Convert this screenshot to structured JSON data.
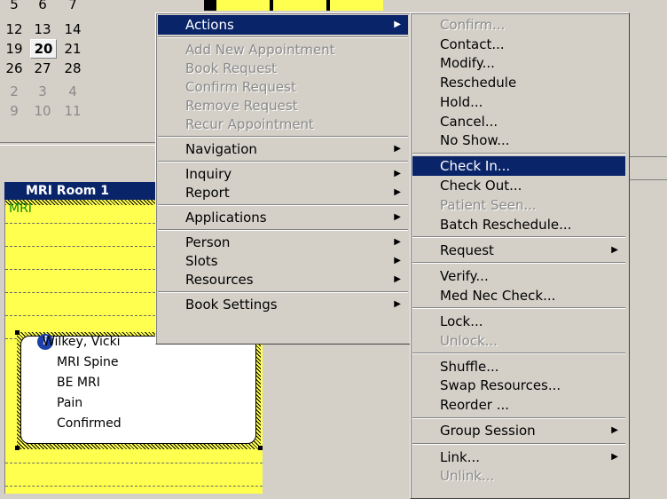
{
  "calendar": {
    "rows": [
      {
        "cells": [
          {
            "t": "5",
            "dim": false
          },
          {
            "t": "6",
            "dim": false
          },
          {
            "t": "7",
            "dim": false
          }
        ]
      },
      {
        "cells": [
          {
            "t": "12",
            "dim": false
          },
          {
            "t": "13",
            "dim": false
          },
          {
            "t": "14",
            "dim": false
          }
        ]
      },
      {
        "cells": [
          {
            "t": "19",
            "dim": false
          },
          {
            "t": "20",
            "dim": false,
            "today": true
          },
          {
            "t": "21",
            "dim": false
          }
        ]
      },
      {
        "cells": [
          {
            "t": "26",
            "dim": false
          },
          {
            "t": "27",
            "dim": false
          },
          {
            "t": "28",
            "dim": false
          }
        ]
      },
      {
        "cells": [
          {
            "t": "2",
            "dim": true
          },
          {
            "t": "3",
            "dim": true
          },
          {
            "t": "4",
            "dim": true
          }
        ]
      },
      {
        "cells": [
          {
            "t": "9",
            "dim": true
          },
          {
            "t": "10",
            "dim": true
          },
          {
            "t": "11",
            "dim": true
          }
        ]
      }
    ]
  },
  "schedule": {
    "room_header": "MRI Room 1",
    "resource_label": "MRI"
  },
  "appointment": {
    "lines": [
      "Wilkey, Vicki",
      "MRI Spine",
      "BE MRI",
      "Pain",
      "Confirmed"
    ]
  },
  "main_menu": {
    "items": [
      {
        "label": "Actions",
        "submenu": true,
        "selected": true
      },
      {
        "sep": true
      },
      {
        "label": "Add New Appointment",
        "disabled": true
      },
      {
        "label": "Book Request",
        "disabled": true
      },
      {
        "label": "Confirm Request",
        "disabled": true
      },
      {
        "label": "Remove Request",
        "disabled": true
      },
      {
        "label": "Recur Appointment",
        "disabled": true
      },
      {
        "sep": true
      },
      {
        "label": "Navigation",
        "submenu": true
      },
      {
        "sep": true
      },
      {
        "label": "Inquiry",
        "submenu": true
      },
      {
        "label": "Report",
        "submenu": true
      },
      {
        "sep": true
      },
      {
        "label": "Applications",
        "submenu": true
      },
      {
        "sep": true
      },
      {
        "label": "Person",
        "submenu": true
      },
      {
        "label": "Slots",
        "submenu": true
      },
      {
        "label": "Resources",
        "submenu": true
      },
      {
        "sep": true
      },
      {
        "label": "Book Settings",
        "submenu": true
      }
    ]
  },
  "actions_menu": {
    "items": [
      {
        "label": "Confirm...",
        "disabled": true
      },
      {
        "label": "Contact..."
      },
      {
        "label": "Modify..."
      },
      {
        "label": "Reschedule"
      },
      {
        "label": "Hold..."
      },
      {
        "label": "Cancel..."
      },
      {
        "label": "No Show..."
      },
      {
        "sep": true
      },
      {
        "label": "Check In...",
        "selected": true
      },
      {
        "label": "Check Out..."
      },
      {
        "label": "Patient Seen...",
        "disabled": true
      },
      {
        "label": "Batch Reschedule..."
      },
      {
        "sep": true
      },
      {
        "label": "Request",
        "submenu": true
      },
      {
        "sep": true
      },
      {
        "label": "Verify..."
      },
      {
        "label": "Med Nec Check..."
      },
      {
        "sep": true
      },
      {
        "label": "Lock..."
      },
      {
        "label": "Unlock...",
        "disabled": true
      },
      {
        "sep": true
      },
      {
        "label": "Shuffle..."
      },
      {
        "label": "Swap Resources..."
      },
      {
        "label": "Reorder ..."
      },
      {
        "sep": true
      },
      {
        "label": "Group Session",
        "submenu": true
      },
      {
        "sep": true
      },
      {
        "label": "Link...",
        "submenu": true
      },
      {
        "label": "Unlink...",
        "disabled": true
      }
    ]
  },
  "colors": {
    "menu_bg": "#d4d0c8",
    "highlight": "#0a246a",
    "slot_yellow": "#ffff4f",
    "disabled_text": "#8a8a8a"
  }
}
